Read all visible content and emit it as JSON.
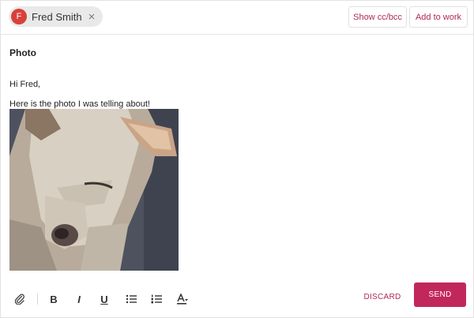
{
  "recipient": {
    "initial": "F",
    "name": "Fred Smith",
    "remove_glyph": "×"
  },
  "header_buttons": {
    "show_cc_bcc": "Show cc/bcc",
    "add_to_work": "Add to work"
  },
  "subject": "Photo",
  "body": {
    "greeting": "Hi Fred,",
    "message": "Here is the photo I was telling about!",
    "image_alt": "dog-photo"
  },
  "toolbar": {
    "icons": [
      "paperclip-icon",
      "bold-icon",
      "italic-icon",
      "underline-icon",
      "bulleted-list-icon",
      "numbered-list-icon",
      "text-color-icon"
    ],
    "bold_glyph": "B",
    "italic_glyph": "I",
    "underline_glyph": "U"
  },
  "actions": {
    "discard": "DISCARD",
    "send": "SEND"
  },
  "colors": {
    "accent": "#c2275c",
    "avatar": "#d8403a",
    "chip_bg": "#e9e9e9"
  }
}
